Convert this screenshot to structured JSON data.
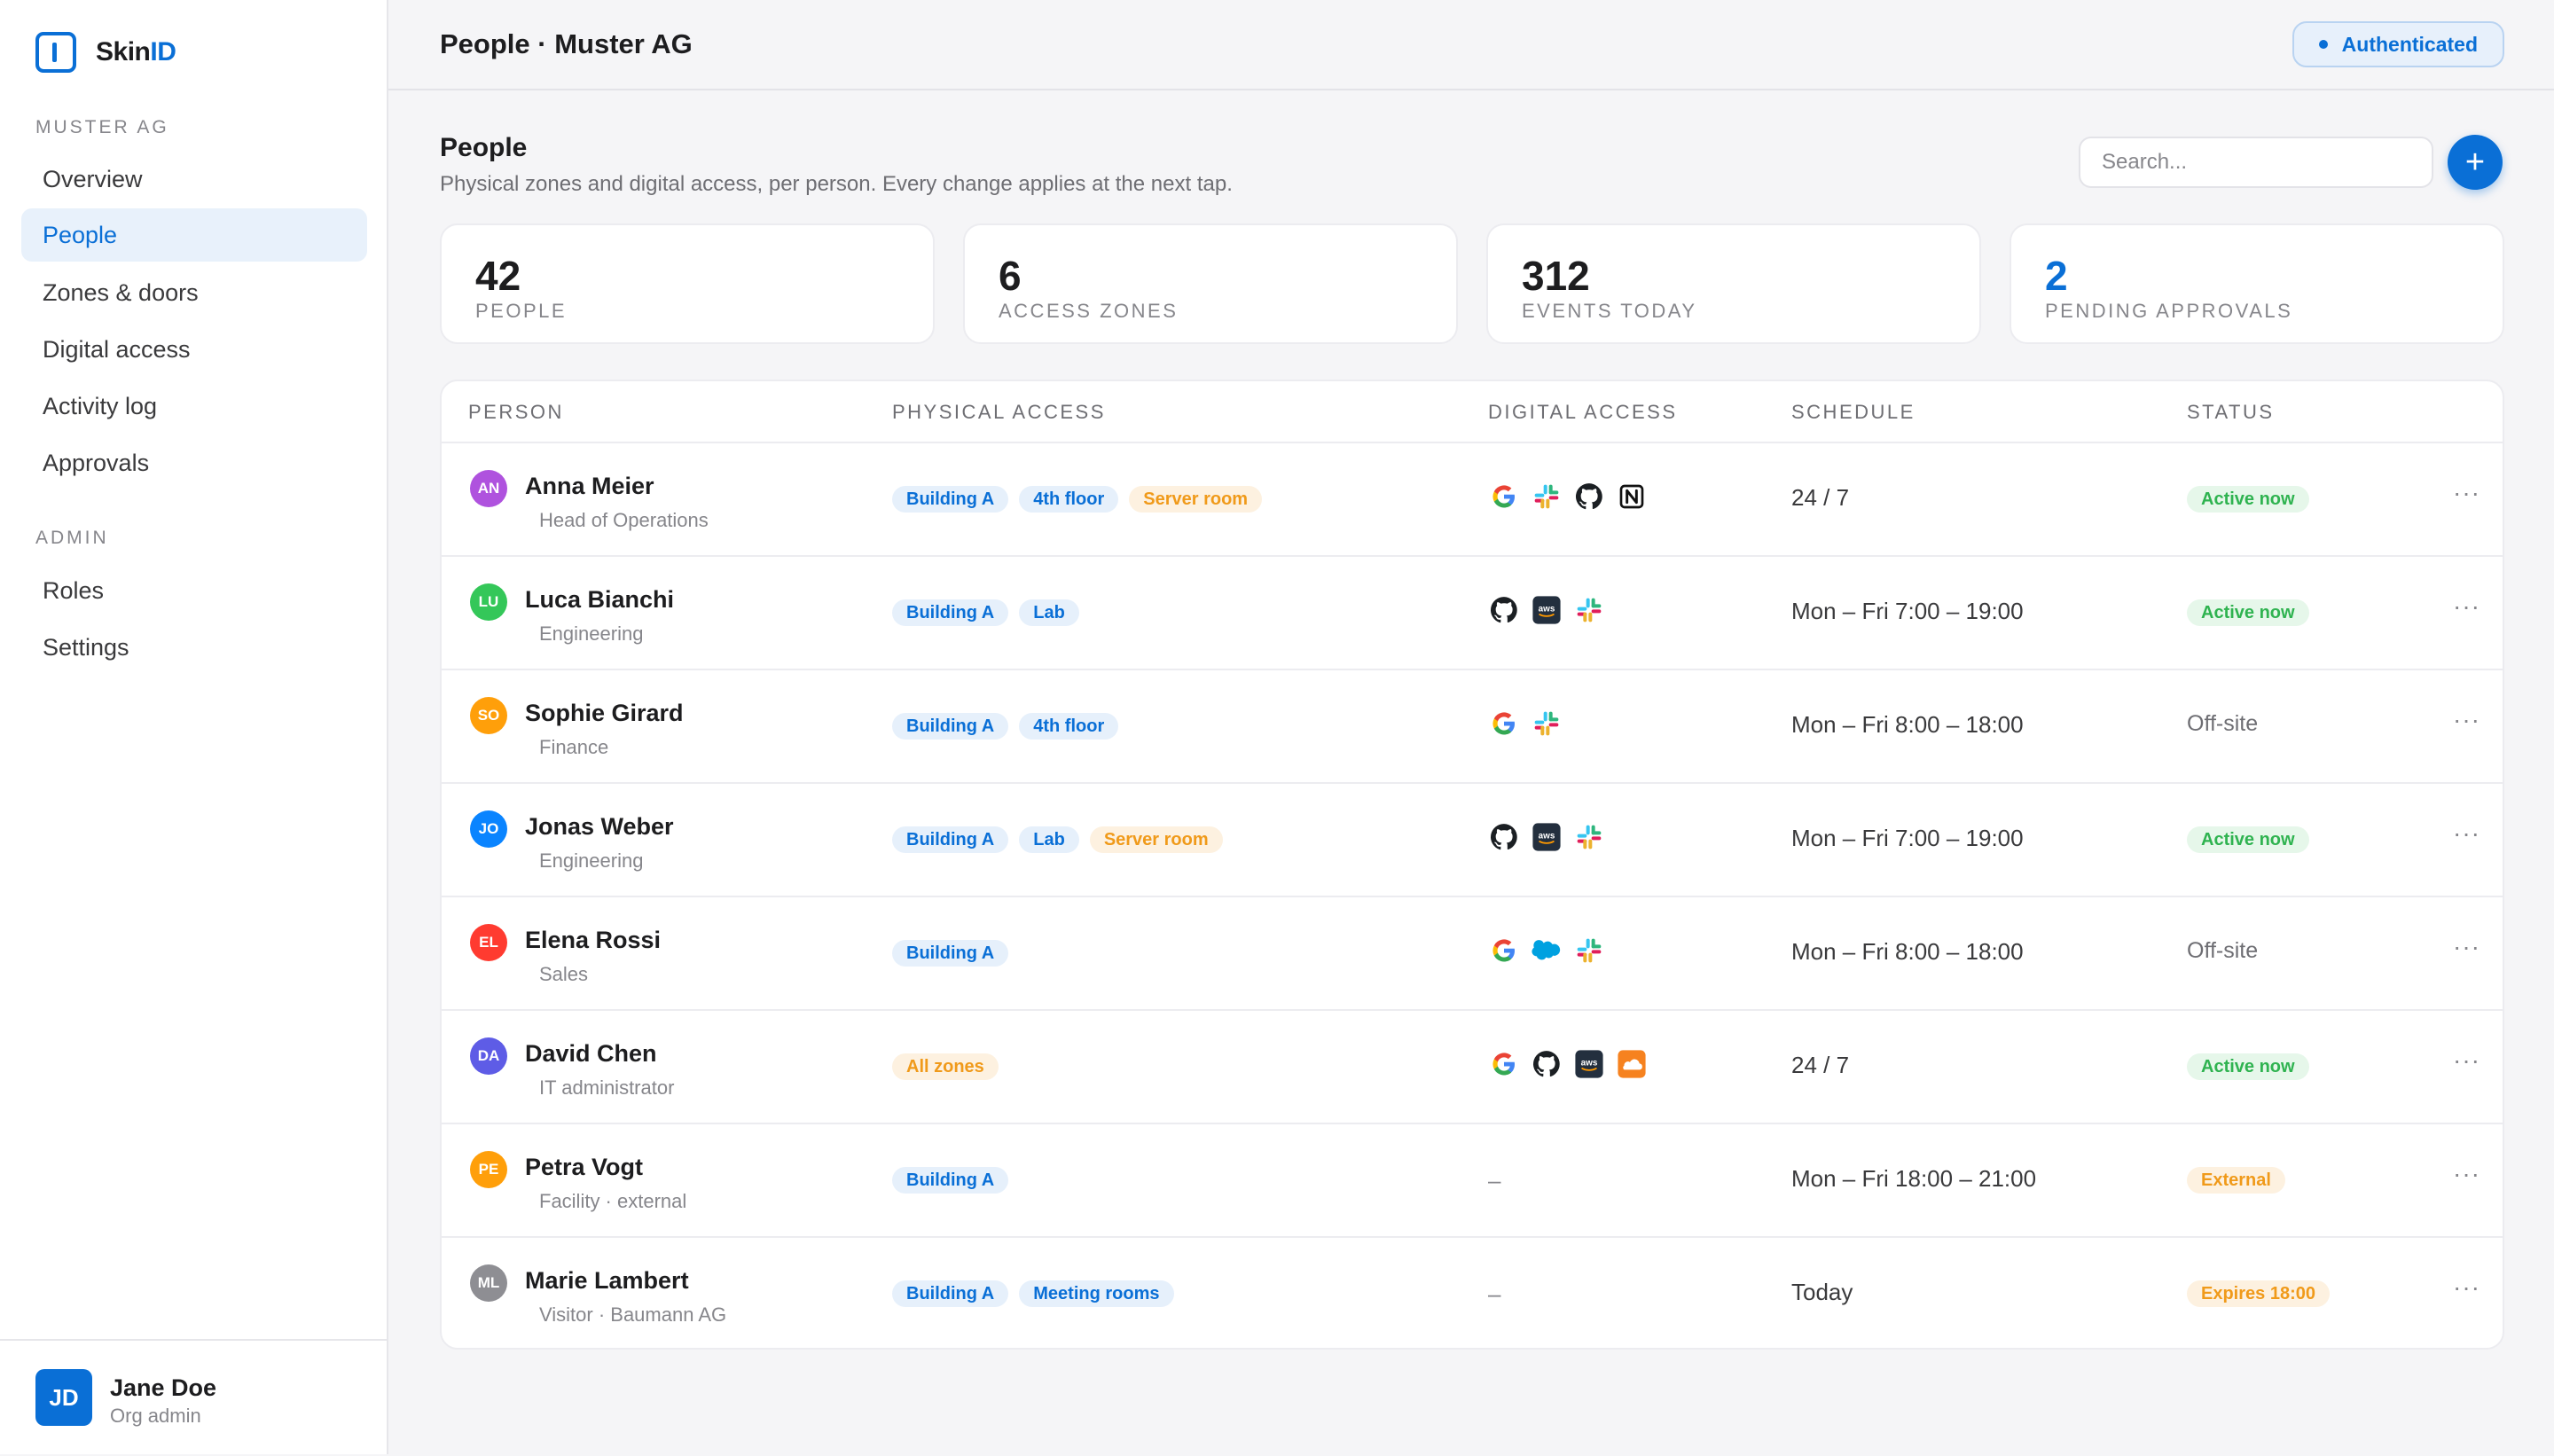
{
  "app": {
    "name_main": "Skin",
    "name_accent": "ID",
    "accent_color": "#0a6fd6"
  },
  "sidebar": {
    "org_section": "MUSTER AG",
    "items": [
      {
        "label": "Overview"
      },
      {
        "label": "People",
        "active": true
      },
      {
        "label": "Zones & doors"
      },
      {
        "label": "Digital access"
      },
      {
        "label": "Activity log"
      },
      {
        "label": "Approvals"
      }
    ],
    "admin_section": "ADMIN",
    "admin_items": [
      {
        "label": "Roles"
      },
      {
        "label": "Settings"
      }
    ],
    "user": {
      "initials": "JD",
      "name": "Jane Doe",
      "role": "Org admin"
    }
  },
  "topbar": {
    "title": "People · Muster AG",
    "auth_badge": "Authenticated"
  },
  "header": {
    "title": "People",
    "subtitle": "Physical zones and digital access, per person. Every change applies at the next tap.",
    "search_placeholder": "Search...",
    "add_label": "+"
  },
  "stats": [
    {
      "value": "42",
      "label": "PEOPLE"
    },
    {
      "value": "6",
      "label": "ACCESS ZONES"
    },
    {
      "value": "312",
      "label": "EVENTS TODAY"
    },
    {
      "value": "2",
      "label": "PENDING APPROVALS",
      "highlight": true
    }
  ],
  "table": {
    "columns": [
      "PERSON",
      "PHYSICAL ACCESS",
      "DIGITAL ACCESS",
      "SCHEDULE",
      "STATUS"
    ],
    "more_label": "···",
    "rows": [
      {
        "initials": "AN",
        "avatar_color": "#af52de",
        "name": "Anna Meier",
        "role": "Head of Operations",
        "zones": [
          {
            "label": "Building A",
            "tone": "blue"
          },
          {
            "label": "4th floor",
            "tone": "blue"
          },
          {
            "label": "Server room",
            "tone": "orange"
          }
        ],
        "apps": [
          "google-icon",
          "slack-icon",
          "github-icon",
          "notion-icon"
        ],
        "digital_none": "",
        "schedule": "24 / 7",
        "status": "Active now",
        "status_tone": "green"
      },
      {
        "initials": "LU",
        "avatar_color": "#34c759",
        "name": "Luca Bianchi",
        "role": "Engineering",
        "zones": [
          {
            "label": "Building A",
            "tone": "blue"
          },
          {
            "label": "Lab",
            "tone": "blue"
          }
        ],
        "apps": [
          "github-icon",
          "aws-icon",
          "slack-icon"
        ],
        "digital_none": "",
        "schedule": "Mon – Fri 7:00 – 19:00",
        "status": "Active now",
        "status_tone": "green"
      },
      {
        "initials": "SO",
        "avatar_color": "#ff9f0a",
        "name": "Sophie Girard",
        "role": "Finance",
        "zones": [
          {
            "label": "Building A",
            "tone": "blue"
          },
          {
            "label": "4th floor",
            "tone": "blue"
          }
        ],
        "apps": [
          "google-icon",
          "slack-icon"
        ],
        "digital_none": "",
        "schedule": "Mon – Fri 8:00 – 18:00",
        "status": "Off-site",
        "status_tone": "plain"
      },
      {
        "initials": "JO",
        "avatar_color": "#0a84ff",
        "name": "Jonas Weber",
        "role": "Engineering",
        "zones": [
          {
            "label": "Building A",
            "tone": "blue"
          },
          {
            "label": "Lab",
            "tone": "blue"
          },
          {
            "label": "Server room",
            "tone": "orange"
          }
        ],
        "apps": [
          "github-icon",
          "aws-icon",
          "slack-icon"
        ],
        "digital_none": "",
        "schedule": "Mon – Fri 7:00 – 19:00",
        "status": "Active now",
        "status_tone": "green"
      },
      {
        "initials": "EL",
        "avatar_color": "#ff3b30",
        "name": "Elena Rossi",
        "role": "Sales",
        "zones": [
          {
            "label": "Building A",
            "tone": "blue"
          }
        ],
        "apps": [
          "google-icon",
          "salesforce-icon",
          "slack-icon"
        ],
        "digital_none": "",
        "schedule": "Mon – Fri 8:00 – 18:00",
        "status": "Off-site",
        "status_tone": "plain"
      },
      {
        "initials": "DA",
        "avatar_color": "#5e5ce6",
        "name": "David Chen",
        "role": "IT administrator",
        "zones": [
          {
            "label": "All zones",
            "tone": "orange"
          }
        ],
        "apps": [
          "google-icon",
          "github-icon",
          "aws-icon",
          "cloudflare-icon"
        ],
        "digital_none": "",
        "schedule": "24 / 7",
        "status": "Active now",
        "status_tone": "green"
      },
      {
        "initials": "PE",
        "avatar_color": "#ff9f0a",
        "name": "Petra Vogt",
        "role": "Facility · external",
        "zones": [
          {
            "label": "Building A",
            "tone": "blue"
          }
        ],
        "apps": [],
        "digital_none": "–",
        "schedule": "Mon – Fri 18:00 – 21:00",
        "status": "External",
        "status_tone": "orange"
      },
      {
        "initials": "ML",
        "avatar_color": "#8e8e93",
        "name": "Marie Lambert",
        "role": "Visitor · Baumann AG",
        "zones": [
          {
            "label": "Building A",
            "tone": "blue"
          },
          {
            "label": "Meeting rooms",
            "tone": "blue"
          }
        ],
        "apps": [],
        "digital_none": "–",
        "schedule": "Today",
        "status": "Expires 18:00",
        "status_tone": "orange"
      }
    ]
  }
}
